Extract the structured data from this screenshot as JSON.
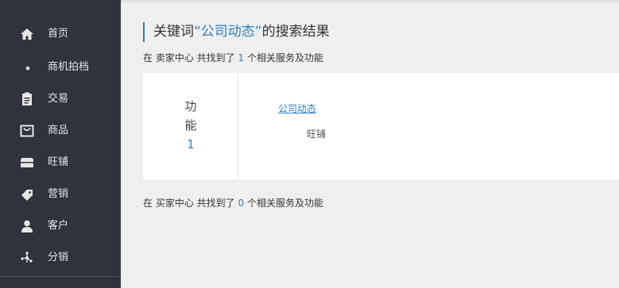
{
  "sidebar": {
    "items": [
      {
        "label": "首页",
        "icon": "home-icon"
      },
      {
        "label": "商机拍档",
        "icon": "dot-icon"
      },
      {
        "label": "交易",
        "icon": "clipboard-icon"
      },
      {
        "label": "商品",
        "icon": "bag-icon"
      },
      {
        "label": "旺铺",
        "icon": "store-icon"
      },
      {
        "label": "营销",
        "icon": "tag-icon"
      },
      {
        "label": "客户",
        "icon": "user-icon"
      },
      {
        "label": "分销",
        "icon": "network-icon"
      }
    ]
  },
  "search": {
    "title_prefix": "关键词",
    "keyword": "“公司动态”",
    "title_suffix": "的搜索结果"
  },
  "seller_summary": {
    "prefix": "在 卖家中心 共找到了",
    "count": "1",
    "suffix": "个相关服务及功能"
  },
  "result_card": {
    "category_char1": "功",
    "category_char2": "能",
    "category_count": "1",
    "link_text": "公司动态",
    "sub_text": "旺铺"
  },
  "buyer_summary": {
    "prefix": "在 买家中心 共找到了",
    "count": "0",
    "suffix": "个相关服务及功能"
  },
  "colors": {
    "sidebar_bg": "#2f333d",
    "accent": "#2a80c6",
    "page_bg": "#efefef"
  }
}
